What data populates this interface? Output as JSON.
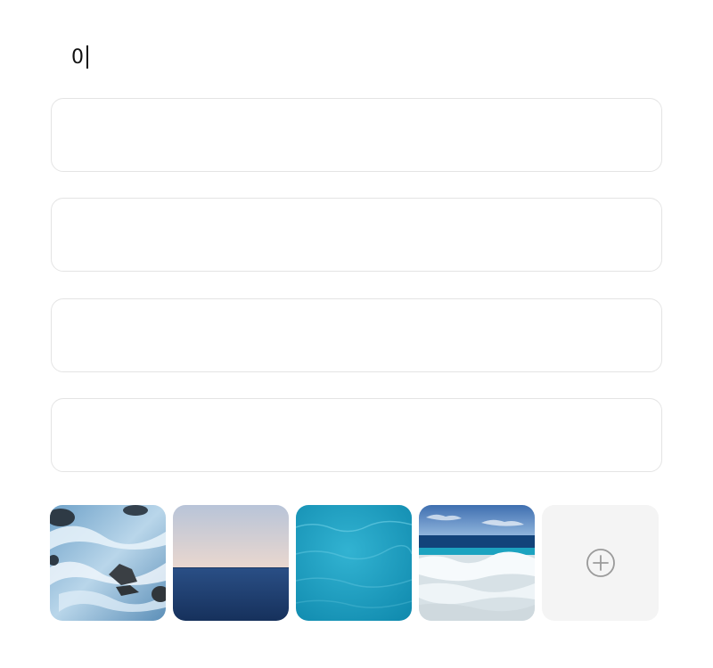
{
  "counter": {
    "value": "0"
  },
  "fields": [
    {
      "value": "",
      "placeholder": ""
    },
    {
      "value": "",
      "placeholder": ""
    },
    {
      "value": "",
      "placeholder": ""
    },
    {
      "value": "",
      "placeholder": ""
    }
  ],
  "thumbnails": [
    {
      "subject": "waves-crashing-on-rocks"
    },
    {
      "subject": "sea-horizon-at-dusk"
    },
    {
      "subject": "turquoise-water-surface"
    },
    {
      "subject": "beach-with-breaking-waves"
    }
  ],
  "add_tile": {
    "icon": "plus-circle-icon"
  },
  "colors": {
    "field_border": "#e4e4e4",
    "add_tile_bg": "#f4f4f4",
    "icon_gray": "#9a9a9a"
  }
}
